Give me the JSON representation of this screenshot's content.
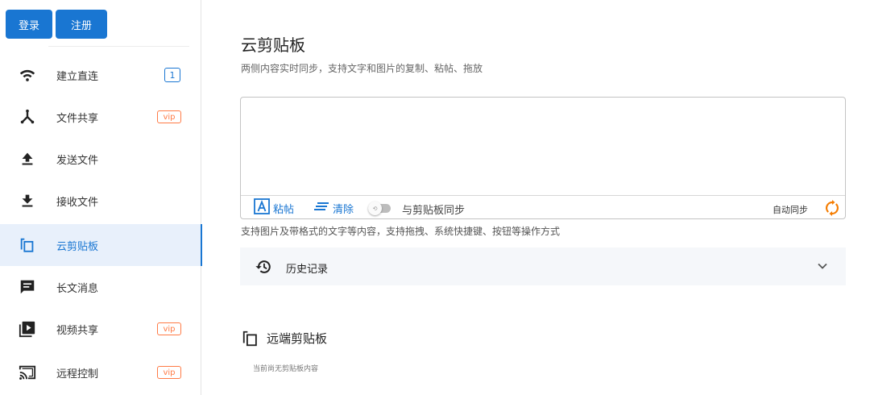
{
  "auth": {
    "login_label": "登录",
    "register_label": "注册"
  },
  "sidebar": {
    "items": [
      {
        "label": "建立直连",
        "icon": "wifi-icon",
        "badge": "1",
        "badge_type": "count"
      },
      {
        "label": "文件共享",
        "icon": "share-icon",
        "badge": "vip",
        "badge_type": "vip"
      },
      {
        "label": "发送文件",
        "icon": "upload-icon"
      },
      {
        "label": "接收文件",
        "icon": "download-icon"
      },
      {
        "label": "云剪贴板",
        "icon": "clipboard-icon",
        "active": true
      },
      {
        "label": "长文消息",
        "icon": "message-icon"
      },
      {
        "label": "视频共享",
        "icon": "video-icon",
        "badge": "vip",
        "badge_type": "vip"
      },
      {
        "label": "远程控制",
        "icon": "cast-icon",
        "badge": "vip",
        "badge_type": "vip"
      }
    ]
  },
  "main": {
    "title": "云剪贴板",
    "subtitle": "两侧内容实时同步，支持文字和图片的复制、粘帖、拖放",
    "editor": {
      "paste_label": "粘帖",
      "clear_label": "清除",
      "sync_toggle_label": "与剪贴板同步",
      "sync_toggle_on": false,
      "auto_sync_label": "自动同步"
    },
    "hint": "支持图片及带格式的文字等内容，支持拖拽、系统快捷键、按钮等操作方式",
    "history_label": "历史记录",
    "remote": {
      "title": "远端剪贴板",
      "empty_text": "当前尚无剪贴板内容"
    }
  },
  "colors": {
    "accent": "#1976d2",
    "vip": "#ff7a45",
    "sync_orange": "#f57c00"
  }
}
